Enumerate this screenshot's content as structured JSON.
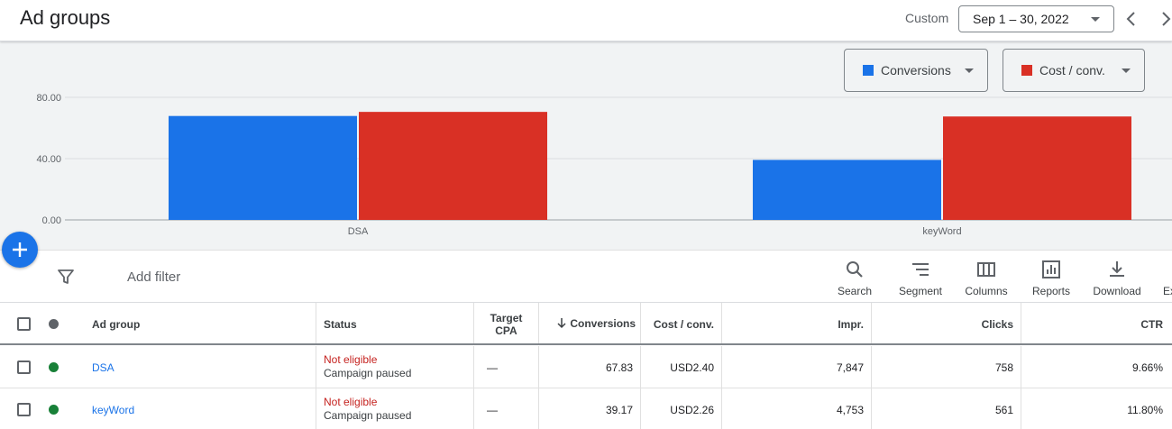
{
  "header": {
    "title": "Ad groups",
    "date_label": "Custom",
    "date_range": "Sep 1 – 30, 2022"
  },
  "chart_controls": {
    "metric1": {
      "label": "Conversions",
      "color": "#1a73e8"
    },
    "metric2": {
      "label": "Cost / conv.",
      "color": "#d93025"
    }
  },
  "chart_data": {
    "type": "bar",
    "categories": [
      "DSA",
      "keyWord"
    ],
    "series": [
      {
        "name": "Conversions",
        "values": [
          67.83,
          39.17
        ],
        "color": "#1a73e8"
      },
      {
        "name": "Cost / conv.",
        "values": [
          70.5,
          67.5
        ],
        "color": "#d93025"
      }
    ],
    "yticks": [
      "0.00",
      "40.00",
      "80.00"
    ],
    "ylim": [
      0,
      80
    ],
    "grid": true
  },
  "toolbar": {
    "add_filter": "Add filter",
    "tools": [
      {
        "label": "Search",
        "icon": "search-icon"
      },
      {
        "label": "Segment",
        "icon": "segment-icon"
      },
      {
        "label": "Columns",
        "icon": "columns-icon"
      },
      {
        "label": "Reports",
        "icon": "reports-icon"
      },
      {
        "label": "Download",
        "icon": "download-icon"
      },
      {
        "label": "Ex",
        "icon": "expand-icon"
      }
    ]
  },
  "table": {
    "headers": {
      "ad_group": "Ad group",
      "status": "Status",
      "target_cpa_1": "Target",
      "target_cpa_2": "CPA",
      "conversions": "Conversions",
      "cost_conv": "Cost / conv.",
      "impr": "Impr.",
      "clicks": "Clicks",
      "ctr": "CTR"
    },
    "rows": [
      {
        "name": "DSA",
        "status": "Not eligible",
        "substatus": "Campaign paused",
        "target_cpa": "—",
        "conversions": "67.83",
        "cost_conv": "USD2.40",
        "impr": "7,847",
        "clicks": "758",
        "ctr": "9.66%",
        "status_dot_color": "#188038"
      },
      {
        "name": "keyWord",
        "status": "Not eligible",
        "substatus": "Campaign paused",
        "target_cpa": "—",
        "conversions": "39.17",
        "cost_conv": "USD2.26",
        "impr": "4,753",
        "clicks": "561",
        "ctr": "11.80%",
        "status_dot_color": "#188038"
      }
    ]
  }
}
